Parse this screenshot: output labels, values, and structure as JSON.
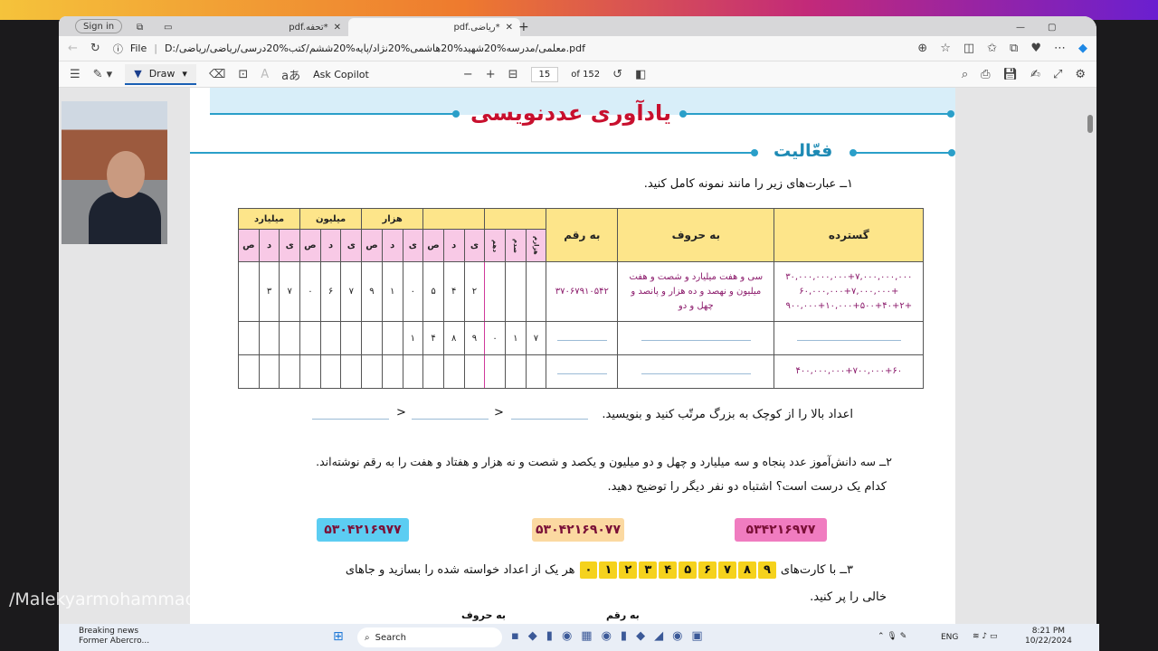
{
  "browser": {
    "sign_in": "Sign in",
    "tabs": [
      {
        "label": "pdf.تحفه*"
      },
      {
        "label": "pdf.ریاضی*"
      }
    ],
    "new_tab": "+",
    "url_prefix": "File",
    "url": "D:/معلمی/مدرسه%20شهید%20هاشمی%20نژاد/پایه%20ششم/کتب%20درسی/ریاضی/ریاضی.pdf"
  },
  "toolbar": {
    "draw": "Draw",
    "ask_copilot": "Ask Copilot",
    "page": "15",
    "of_pages": "of 152"
  },
  "doc": {
    "title": "یادآوری عددنویسی",
    "activity": "فعّالیت",
    "q1": "۱ــ عبارت‌های زیر را مانند نمونه کامل کنید.",
    "table": {
      "group_headers": [
        "میلیارد",
        "میلیون",
        "هزار",
        "",
        ""
      ],
      "col_headers": [
        "گسترده",
        "به حروف",
        "به رقم"
      ],
      "digit_headers": [
        "ص",
        "د",
        "ی",
        "ص",
        "د",
        "ی",
        "ص",
        "د",
        "ی",
        "ص",
        "د",
        "ی",
        "دهم",
        "صدم",
        "هزارم"
      ],
      "rows": [
        {
          "expanded": "۳۰,۰۰۰,۰۰۰,۰۰۰+۷,۰۰۰,۰۰۰,۰۰۰ +۶۰,۰۰۰,۰۰۰+۷,۰۰۰,۰۰۰ +۹۰۰,۰۰۰+۱۰,۰۰۰+۵۰۰+۴۰+۲",
          "words": "سی و هفت میلیارد و شصت و هفت میلیون و نهصد و ده هزار و پانصد و چهل و دو",
          "number": "۳۷۰۶۷۹۱۰۵۴۲",
          "digits": [
            "",
            "۳",
            "۷",
            "۰",
            "۶",
            "۷",
            "۹",
            "۱",
            "۰",
            "۵",
            "۴",
            "۲",
            "",
            "",
            ""
          ]
        },
        {
          "expanded": "",
          "words": "",
          "number": "",
          "digits": [
            "",
            "",
            "",
            "",
            "",
            "",
            "",
            "",
            "۱",
            "۴",
            "۸",
            "۹",
            "۰",
            "۱",
            "۷"
          ]
        },
        {
          "expanded": "۴۰۰,۰۰۰,۰۰۰+۷۰۰,۰۰۰+۶۰",
          "words": "",
          "number": "",
          "digits": [
            "",
            "",
            "",
            "",
            "",
            "",
            "",
            "",
            "",
            "",
            "",
            "",
            "",
            "",
            ""
          ]
        }
      ]
    },
    "order_text": "اعداد بالا را از کوچک به بزرگ مرتّب کنید و بنویسید.",
    "lt": "<",
    "q2_line1": "۲ــ سه دانش‌آموز عدد پنجاه و سه میلیارد و چهل و دو میلیون و یکصد و شصت و نه هزار و هفتاد و هفت را به رقم نوشته‌اند.",
    "q2_line2": "کدام یک درست است؟ اشتباه دو نفر دیگر را توضیح دهید.",
    "answers": [
      {
        "value": "۵۳۰۴۲۱۶۹۷۷",
        "color": "#5ccdf2"
      },
      {
        "value": "۵۳۰۴۲۱۶۹۰۷۷",
        "color": "#fbd9a1"
      },
      {
        "value": "۵۳۴۲۱۶۹۷۷",
        "color": "#f07cc0"
      }
    ],
    "q3_start": "۳ــ با کارت‌های",
    "cards": [
      "۹",
      "۸",
      "۷",
      "۶",
      "۵",
      "۴",
      "۳",
      "۲",
      "۱",
      "۰"
    ],
    "q3_end": "هر یک از اعداد خواسته شده را بسازید و جاهای",
    "q3_line2": "خالی را پر کنید.",
    "col_words": "به حروف",
    "col_number": "به رقم"
  },
  "watermark": "/Malekyarmohammadi",
  "taskbar": {
    "news_title": "Breaking news",
    "news_sub": "Former Abercro...",
    "search": "Search",
    "lang": "ENG",
    "time": "8:21 PM",
    "date": "10/22/2024"
  }
}
